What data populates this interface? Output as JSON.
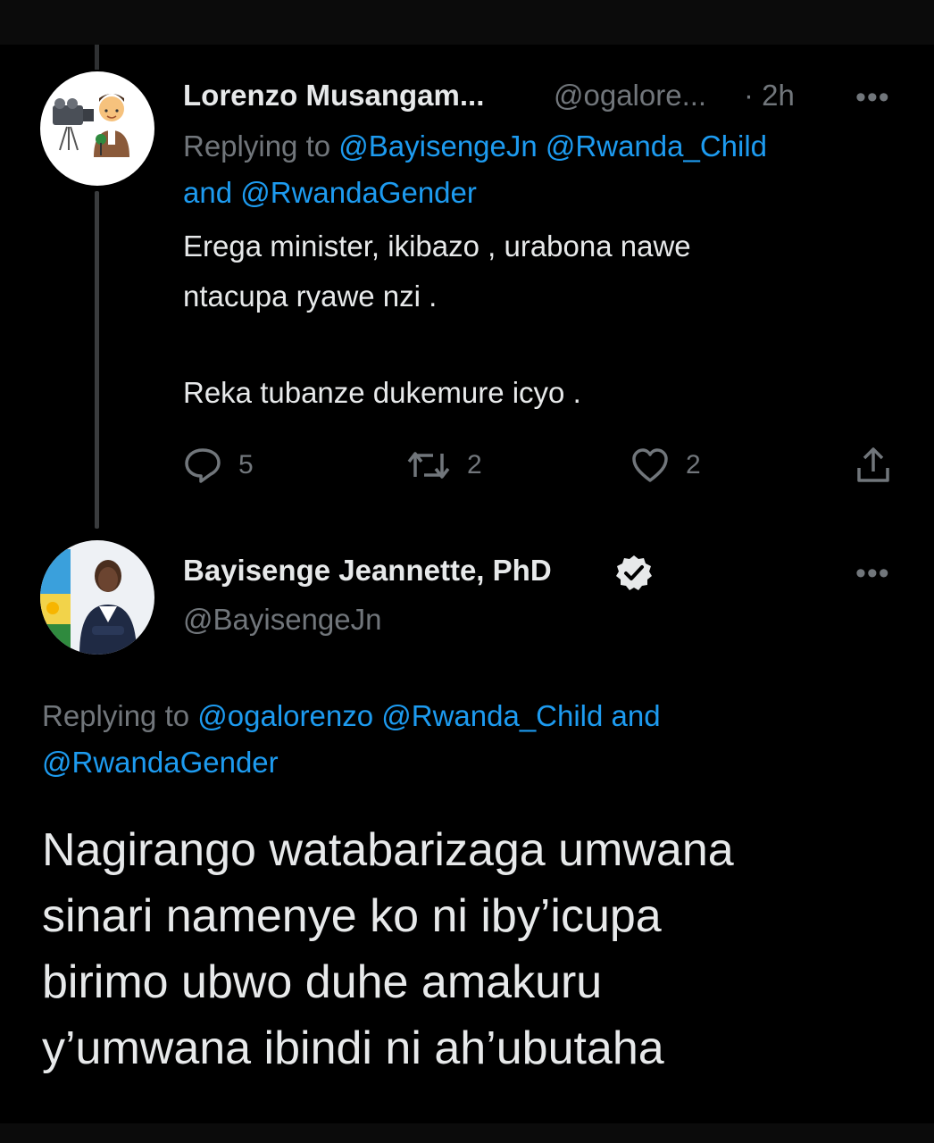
{
  "reply_tweet": {
    "author_name": "Lorenzo Musangam...",
    "author_handle": "@ogalore...",
    "time": "· 2h",
    "more_label": "•••",
    "replying_prefix": "Replying to",
    "replying_line1_mentions": "@BayisengeJn @Rwanda_Child",
    "replying_line2_and": "and",
    "replying_line2_mention": "@RwandaGender",
    "text_line1": "Erega minister, ikibazo , urabona nawe",
    "text_line2": "ntacupa ryawe nzi .",
    "text_line3": "Reka tubanze dukemure icyo .",
    "actions": {
      "reply_count": "5",
      "retweet_count": "2",
      "like_count": "2"
    }
  },
  "main_tweet": {
    "author_name": "Bayisenge Jeannette, PhD",
    "author_handle": "@BayisengeJn",
    "verified": true,
    "more_label": "•••",
    "replying_prefix": "Replying to",
    "replying_line1_mentions": "@ogalorenzo @Rwanda_Child and",
    "replying_line2_mention": "@RwandaGender",
    "text_line1": "Nagirango watabarizaga umwana",
    "text_line2": "sinari namenye ko ni iby’icupa",
    "text_line3": "birimo ubwo duhe amakuru",
    "text_line4": "y’umwana ibindi ni ah’ubutaha"
  },
  "colors": {
    "background": "#000000",
    "text_primary": "#e7e9ea",
    "text_secondary": "#71767b",
    "link": "#1d9bf0"
  },
  "icons": [
    "reply-icon",
    "retweet-icon",
    "like-icon",
    "share-icon",
    "verified-badge-icon",
    "more-icon"
  ]
}
